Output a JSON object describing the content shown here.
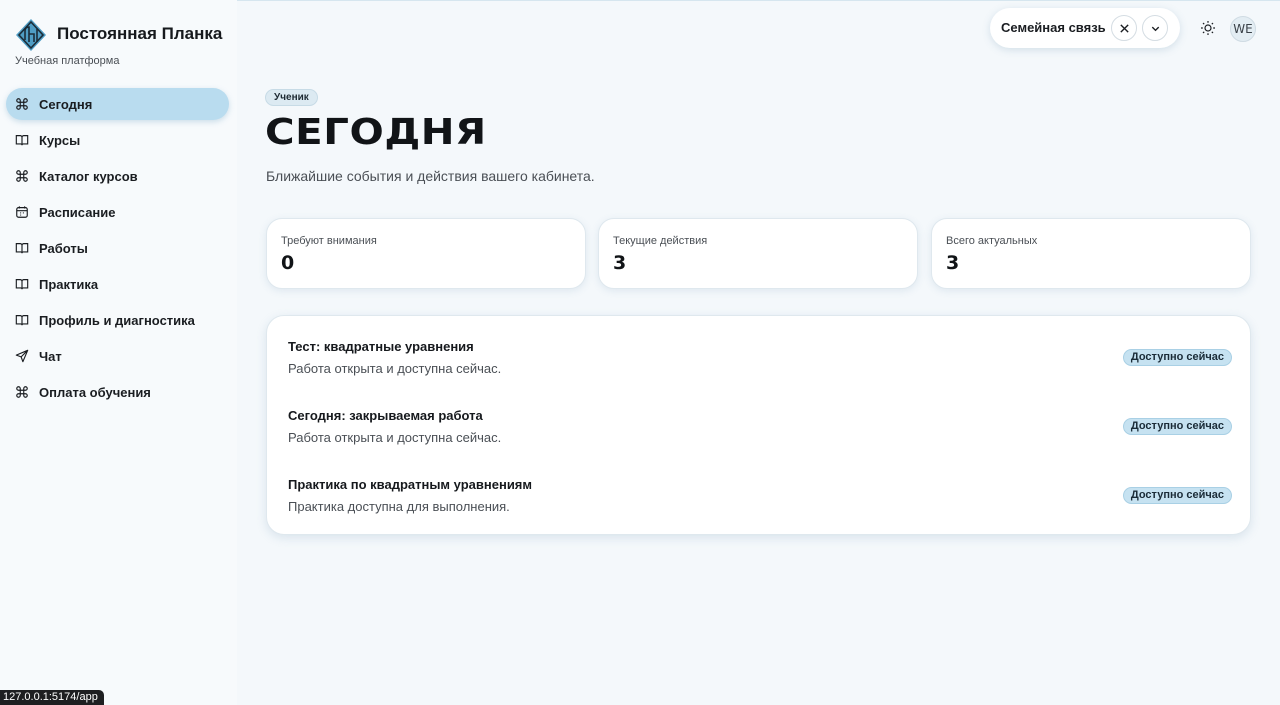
{
  "brand": {
    "name": "Постоянная Планка",
    "subtitle": "Учебная платформа",
    "accent": "#b9dcef"
  },
  "sidebar": {
    "items": [
      {
        "label": "Сегодня",
        "icon": "command-icon",
        "active": true
      },
      {
        "label": "Курсы",
        "icon": "book-icon",
        "active": false
      },
      {
        "label": "Каталог курсов",
        "icon": "command-icon",
        "active": false
      },
      {
        "label": "Расписание",
        "icon": "calendar-icon",
        "active": false
      },
      {
        "label": "Работы",
        "icon": "book-icon",
        "active": false
      },
      {
        "label": "Практика",
        "icon": "book-icon",
        "active": false
      },
      {
        "label": "Профиль и диагностика",
        "icon": "book-icon",
        "active": false
      },
      {
        "label": "Чат",
        "icon": "send-icon",
        "active": false
      },
      {
        "label": "Оплата обучения",
        "icon": "command-icon",
        "active": false
      }
    ]
  },
  "header": {
    "family_label": "Семейная связь",
    "avatar_initials": "WE"
  },
  "main": {
    "role_badge": "Ученик",
    "title": "СЕГОДНЯ",
    "subtitle": "Ближайшие события и действия вашего кабинета.",
    "stats": [
      {
        "label": "Требуют внимания",
        "value": "0"
      },
      {
        "label": "Текущие действия",
        "value": "3"
      },
      {
        "label": "Всего актуальных",
        "value": "3"
      }
    ],
    "events": [
      {
        "title": "Тест: квадратные уравнения",
        "description": "Работа открыта и доступна сейчас.",
        "badge": "Доступно сейчас"
      },
      {
        "title": "Сегодня: закрываемая работа",
        "description": "Работа открыта и доступна сейчас.",
        "badge": "Доступно сейчас"
      },
      {
        "title": "Практика по квадратным уравнениям",
        "description": "Практика доступна для выполнения.",
        "badge": "Доступно сейчас"
      }
    ]
  },
  "status_bar": {
    "url": "127.0.0.1:5174/app"
  }
}
